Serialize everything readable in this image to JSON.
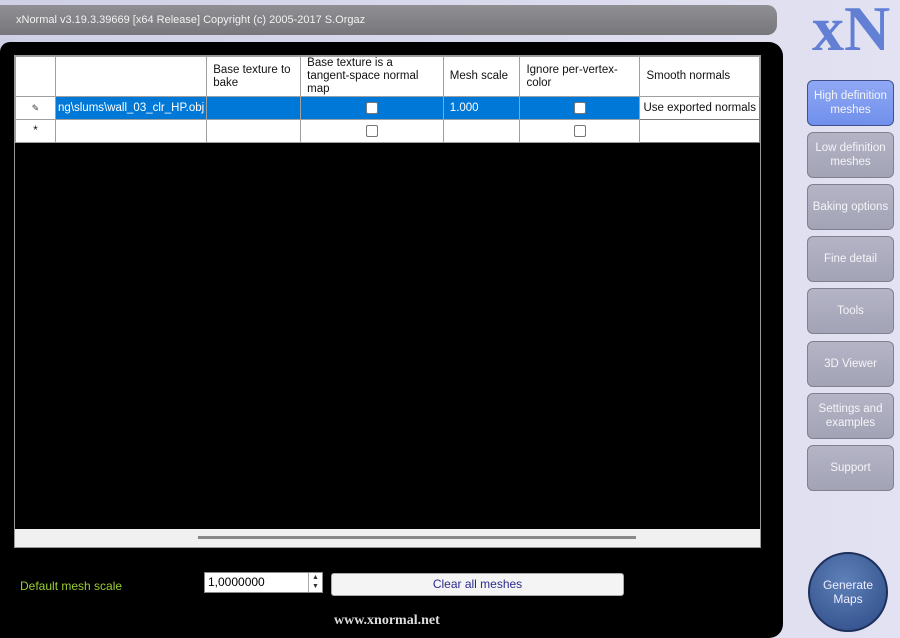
{
  "title": "xNormal v3.19.3.39669 [x64 Release] Copyright (c) 2005-2017 S.Orgaz",
  "logo": "xN",
  "grid": {
    "headers": [
      "",
      "",
      "Base texture to bake",
      "Base texture is a tangent-space normal map",
      "Mesh scale",
      "Ignore per-vertex-color",
      "Smooth normals"
    ],
    "rows": [
      {
        "marker": "✎",
        "file": "ng\\slums\\wall_03_clr_HP.obj",
        "base": "",
        "scale": "1.000",
        "smooth": "Use exported normals"
      },
      {
        "marker": "*",
        "file": "",
        "base": "",
        "scale": "",
        "smooth": ""
      }
    ]
  },
  "bottom": {
    "default_scale_label": "Default mesh scale",
    "default_scale_value": "1,0000000",
    "clear_label": "Clear all meshes",
    "site": "www.xnormal.net"
  },
  "nav": [
    "High definition meshes",
    "Low definition meshes",
    "Baking options",
    "Fine detail",
    "Tools",
    "3D Viewer",
    "Settings and examples",
    "Support"
  ],
  "generate": "Generate Maps"
}
